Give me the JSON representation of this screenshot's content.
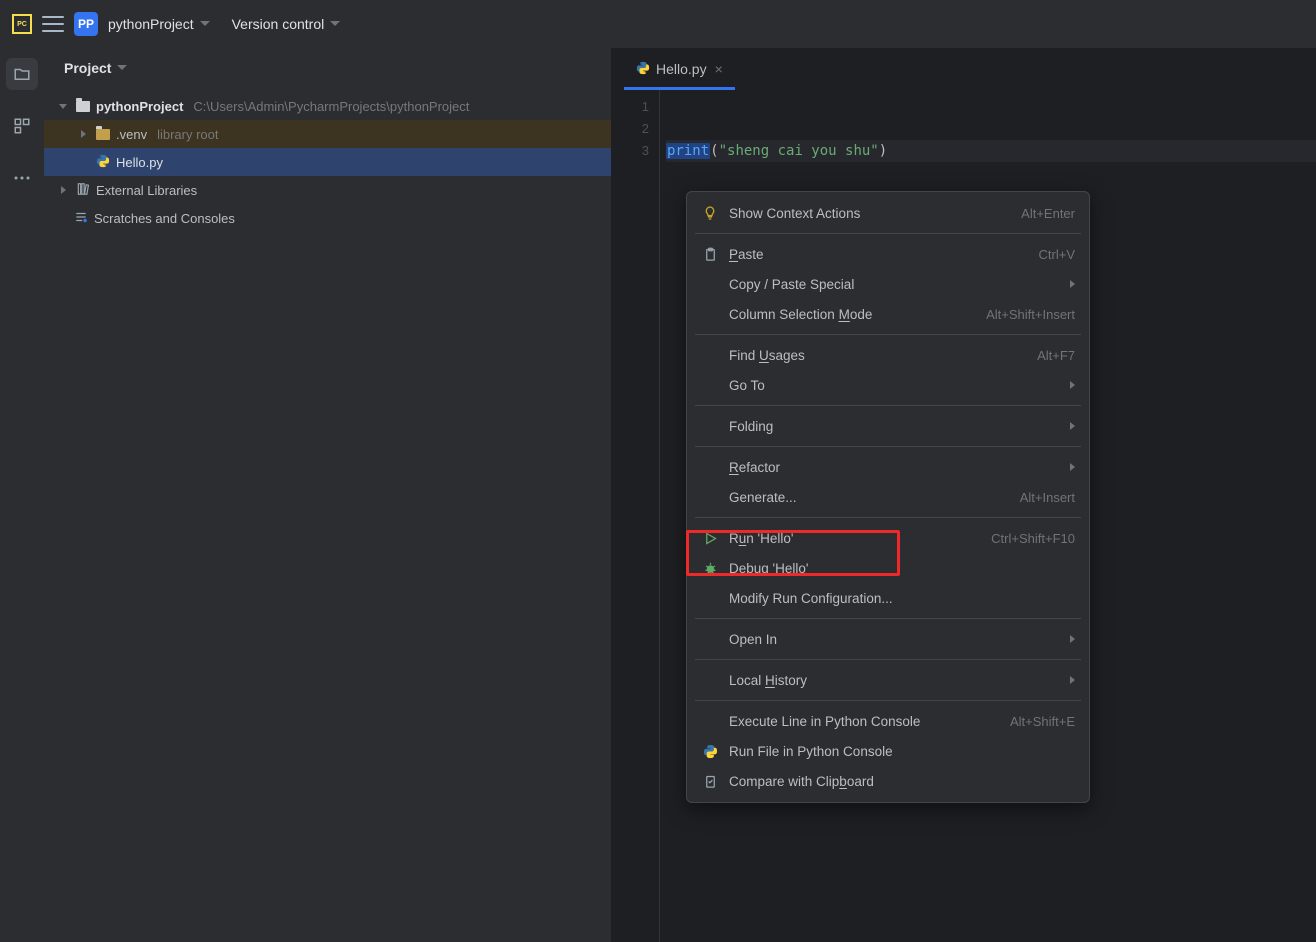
{
  "app": {
    "name": "PyCharm",
    "badge": "PP"
  },
  "topbar": {
    "project_name": "pythonProject",
    "vcs_label": "Version control"
  },
  "leftbar": {
    "items": [
      "project-tool-icon",
      "structure-icon",
      "more-icon"
    ]
  },
  "project_panel": {
    "title": "Project",
    "root": {
      "name": "pythonProject",
      "path": "C:\\Users\\Admin\\PycharmProjects\\pythonProject"
    },
    "venv": {
      "name": ".venv",
      "note": "library root"
    },
    "file": {
      "name": "Hello.py"
    },
    "external": "External Libraries",
    "scratch": "Scratches and Consoles"
  },
  "tab": {
    "filename": "Hello.py"
  },
  "editor": {
    "lines": [
      "",
      "",
      ""
    ],
    "line3": {
      "fn": "print",
      "open": "(",
      "str": "\"sheng cai you shu\"",
      "close": ")"
    }
  },
  "context_menu": {
    "items": [
      {
        "id": "show-context-actions",
        "icon": "bulb",
        "label": "Show Context Actions",
        "shortcut": "Alt+Enter"
      },
      {
        "sep": true
      },
      {
        "id": "paste",
        "icon": "clipboard",
        "label": "Paste",
        "underline": "P",
        "shortcut": "Ctrl+V"
      },
      {
        "id": "copy-paste-special",
        "label": "Copy / Paste Special",
        "submenu": true
      },
      {
        "id": "column-selection",
        "label": "Column Selection Mode",
        "underline": "M",
        "underlinePos": 17,
        "shortcut": "Alt+Shift+Insert"
      },
      {
        "sep": true
      },
      {
        "id": "find-usages",
        "label": "Find Usages",
        "underline": "U",
        "underlinePos": 5,
        "shortcut": "Alt+F7"
      },
      {
        "id": "go-to",
        "label": "Go To",
        "submenu": true
      },
      {
        "sep": true
      },
      {
        "id": "folding",
        "label": "Folding",
        "submenu": true
      },
      {
        "sep": true
      },
      {
        "id": "refactor",
        "label": "Refactor",
        "underline": "R",
        "submenu": true
      },
      {
        "id": "generate",
        "label": "Generate...",
        "shortcut": "Alt+Insert"
      },
      {
        "sep": true
      },
      {
        "id": "run",
        "icon": "play",
        "class": "run",
        "label": "Run 'Hello'",
        "underline": "u",
        "underlinePos": 1,
        "shortcut": "Ctrl+Shift+F10"
      },
      {
        "id": "debug",
        "icon": "bug",
        "class": "debug",
        "label": "Debug 'Hello'",
        "underline": "D"
      },
      {
        "id": "modify-run-config",
        "label": "Modify Run Configuration..."
      },
      {
        "sep": true
      },
      {
        "id": "open-in",
        "label": "Open In",
        "submenu": true
      },
      {
        "sep": true
      },
      {
        "id": "local-history",
        "label": "Local History",
        "underline": "H",
        "underlinePos": 6,
        "submenu": true
      },
      {
        "sep": true
      },
      {
        "id": "exec-console",
        "label": "Execute Line in Python Console",
        "shortcut": "Alt+Shift+E"
      },
      {
        "id": "run-console",
        "icon": "python",
        "label": "Run File in Python Console"
      },
      {
        "id": "compare-clipboard",
        "icon": "clipboard-compare",
        "label": "Compare with Clipboard",
        "underline": "b",
        "underlinePos": 17
      }
    ]
  }
}
